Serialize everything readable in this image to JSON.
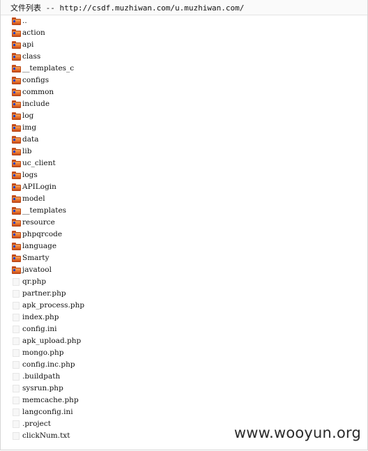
{
  "header": {
    "title": "文件列表 -- http://csdf.muzhiwan.com/u.muzhiwan.com/"
  },
  "entries": [
    {
      "name": "..",
      "type": "folder"
    },
    {
      "name": "action",
      "type": "folder"
    },
    {
      "name": "api",
      "type": "folder"
    },
    {
      "name": "class",
      "type": "folder"
    },
    {
      "name": "__templates_c",
      "type": "folder"
    },
    {
      "name": "configs",
      "type": "folder"
    },
    {
      "name": "common",
      "type": "folder"
    },
    {
      "name": "include",
      "type": "folder"
    },
    {
      "name": "log",
      "type": "folder"
    },
    {
      "name": "img",
      "type": "folder"
    },
    {
      "name": "data",
      "type": "folder"
    },
    {
      "name": "lib",
      "type": "folder"
    },
    {
      "name": "uc_client",
      "type": "folder"
    },
    {
      "name": "logs",
      "type": "folder"
    },
    {
      "name": "APILogin",
      "type": "folder"
    },
    {
      "name": "model",
      "type": "folder"
    },
    {
      "name": "__templates",
      "type": "folder"
    },
    {
      "name": "resource",
      "type": "folder"
    },
    {
      "name": "phpqrcode",
      "type": "folder"
    },
    {
      "name": "language",
      "type": "folder"
    },
    {
      "name": "Smarty",
      "type": "folder"
    },
    {
      "name": "javatool",
      "type": "folder"
    },
    {
      "name": "qr.php",
      "type": "file"
    },
    {
      "name": "partner.php",
      "type": "file"
    },
    {
      "name": "apk_process.php",
      "type": "file"
    },
    {
      "name": "index.php",
      "type": "file"
    },
    {
      "name": "config.ini",
      "type": "file"
    },
    {
      "name": "apk_upload.php",
      "type": "file"
    },
    {
      "name": "mongo.php",
      "type": "file"
    },
    {
      "name": "config.inc.php",
      "type": "file"
    },
    {
      "name": ".buildpath",
      "type": "file"
    },
    {
      "name": "sysrun.php",
      "type": "file"
    },
    {
      "name": "memcache.php",
      "type": "file"
    },
    {
      "name": "langconfig.ini",
      "type": "file"
    },
    {
      "name": ".project",
      "type": "file"
    },
    {
      "name": "clickNum.txt",
      "type": "file"
    }
  ],
  "icons": {
    "folder": "folder-icon",
    "file": "file-icon"
  },
  "colors": {
    "folder_orange": "#e8772f",
    "folder_dark": "#c84a1a",
    "folder_dot": "#1f3fbf"
  },
  "watermark": "www.wooyun.org"
}
